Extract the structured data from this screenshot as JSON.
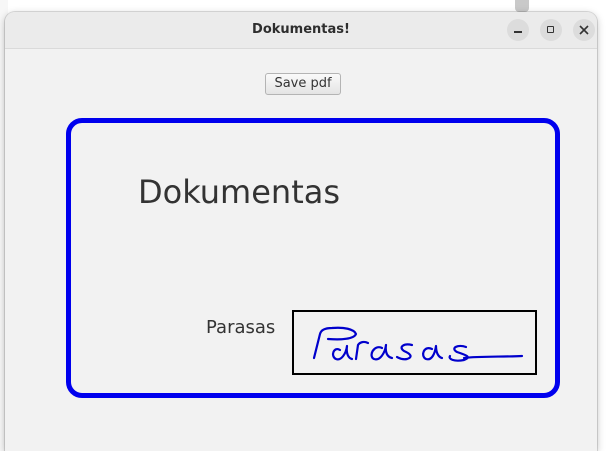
{
  "window": {
    "title": "Dokumentas!",
    "controls": [
      "minimize-icon",
      "maximize-icon",
      "close-icon"
    ]
  },
  "toolbar": {
    "save_label": "Save pdf"
  },
  "document": {
    "title": "Dokumentas",
    "signature_label": "Parasas",
    "signature_handwriting": "Parasas",
    "frame_color": "#0000ee",
    "signature_ink_color": "#0000cc"
  }
}
